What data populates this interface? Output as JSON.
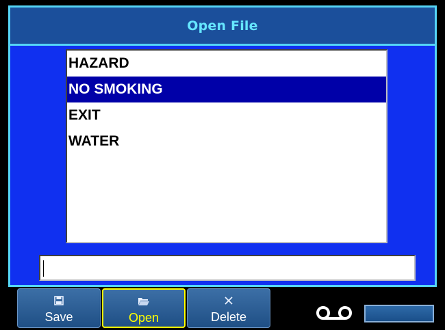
{
  "dialog": {
    "title": "Open File"
  },
  "file_list": {
    "items": [
      {
        "label": "HAZARD",
        "selected": false
      },
      {
        "label": "NO SMOKING",
        "selected": true
      },
      {
        "label": "EXIT",
        "selected": false
      },
      {
        "label": "WATER",
        "selected": false
      }
    ]
  },
  "filename_input": {
    "value": ""
  },
  "softkeys": {
    "save": {
      "label": "Save",
      "icon": "save-icon"
    },
    "open": {
      "label": "Open",
      "icon": "folder-open-icon",
      "active": true
    },
    "delete": {
      "label": "Delete",
      "icon": "close-icon"
    }
  },
  "status": {
    "tape_icon": "tape-cassette-icon",
    "level_indicator": "tape-level-bar"
  },
  "colors": {
    "background": "#000000",
    "frame": "#55d5f6",
    "title_bar": "#1b4f9b",
    "title_text": "#66e6ff",
    "body": "#1030f0",
    "selection": "#0000a8",
    "active_softkey": "#ffff00"
  }
}
